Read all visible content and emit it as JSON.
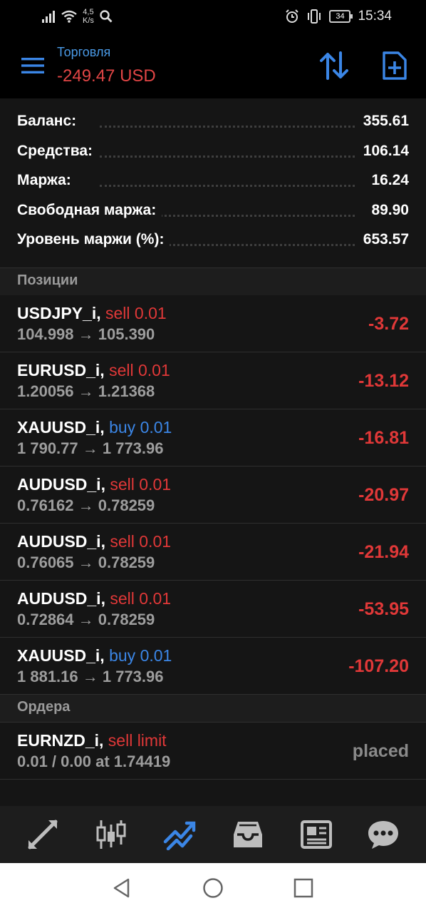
{
  "status_bar": {
    "speed_value": "4,5",
    "speed_unit": "K/s",
    "battery": "34",
    "time": "15:34",
    "icons": [
      "signal-icon",
      "wifi-icon",
      "search-icon",
      "alarm-icon",
      "vibrate-icon",
      "battery-icon"
    ]
  },
  "header": {
    "title": "Торговля",
    "subtitle": "-249.47 USD",
    "menu_icon": "hamburger-icon",
    "sort_icon": "sort-arrows-icon",
    "new_order_icon": "new-order-icon"
  },
  "summary": [
    {
      "label": "Баланс:",
      "value": "355.61"
    },
    {
      "label": "Средства:",
      "value": "106.14"
    },
    {
      "label": "Маржа:",
      "value": "16.24"
    },
    {
      "label": "Свободная маржа:",
      "value": "89.90"
    },
    {
      "label": "Уровень маржи (%):",
      "value": "653.57"
    }
  ],
  "positions_header": "Позиции",
  "positions": [
    {
      "symbol": "USDJPY_i,",
      "type": "sell 0.01",
      "side": "sell",
      "prices": "104.998 → 105.390",
      "profit": "-3.72"
    },
    {
      "symbol": "EURUSD_i,",
      "type": "sell 0.01",
      "side": "sell",
      "prices": "1.20056 → 1.21368",
      "profit": "-13.12"
    },
    {
      "symbol": "XAUUSD_i,",
      "type": "buy 0.01",
      "side": "buy",
      "prices": "1 790.77 → 1 773.96",
      "profit": "-16.81"
    },
    {
      "symbol": "AUDUSD_i,",
      "type": "sell 0.01",
      "side": "sell",
      "prices": "0.76162 → 0.78259",
      "profit": "-20.97"
    },
    {
      "symbol": "AUDUSD_i,",
      "type": "sell 0.01",
      "side": "sell",
      "prices": "0.76065 → 0.78259",
      "profit": "-21.94"
    },
    {
      "symbol": "AUDUSD_i,",
      "type": "sell 0.01",
      "side": "sell",
      "prices": "0.72864 → 0.78259",
      "profit": "-53.95"
    },
    {
      "symbol": "XAUUSD_i,",
      "type": "buy 0.01",
      "side": "buy",
      "prices": "1 881.16 → 1 773.96",
      "profit": "-107.20"
    }
  ],
  "orders_header": "Ордера",
  "orders": [
    {
      "symbol": "EURNZD_i,",
      "type": "sell limit",
      "side": "sell",
      "details": "0.01 / 0.00 at 1.74419",
      "status": "placed"
    }
  ],
  "bottom_nav": [
    {
      "name": "quotes-icon",
      "active": false
    },
    {
      "name": "chart-candles-icon",
      "active": false
    },
    {
      "name": "trade-icon",
      "active": true
    },
    {
      "name": "history-inbox-icon",
      "active": false
    },
    {
      "name": "news-icon",
      "active": false
    },
    {
      "name": "chat-icon",
      "active": false
    }
  ],
  "system_nav": [
    "back-icon",
    "home-icon",
    "recents-icon"
  ],
  "colors": {
    "accent": "#3b86e6",
    "loss": "#e03838",
    "background": "#151515"
  }
}
